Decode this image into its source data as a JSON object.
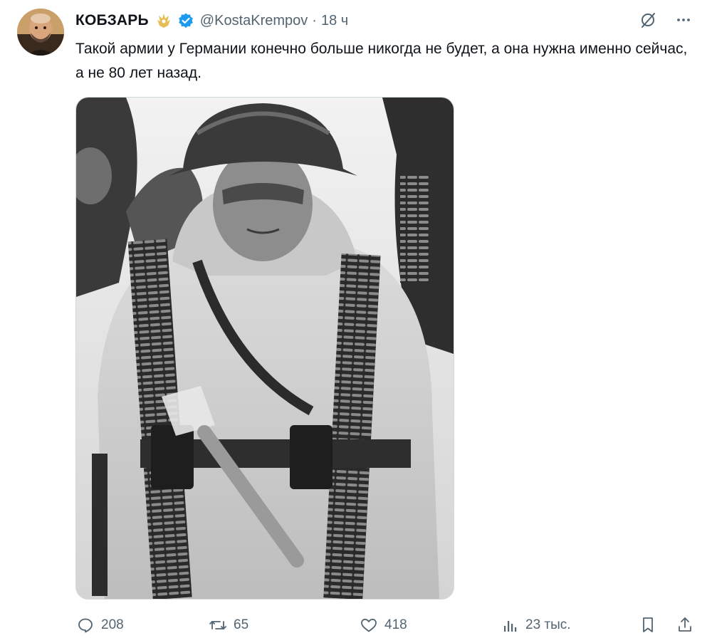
{
  "tweet": {
    "author": {
      "display_name": "КОБЗАРЬ",
      "handle": "@KostaKrempov",
      "separator": "·",
      "time": "18 ч",
      "badge_icon": "trident-icon",
      "verified_icon": "verified-check-icon"
    },
    "text": "Такой армии у Германии конечно больше никогда не будет, а она нужна именно сейчас, а не 80 лет назад.",
    "media": {
      "type": "photo",
      "colors": "black-and-white"
    },
    "top_actions": [
      "grok-icon",
      "more-icon"
    ],
    "actions": {
      "replies": "208",
      "reposts": "65",
      "likes": "418",
      "views": "23 тыс.",
      "bookmark_icon": "bookmark-icon",
      "share_icon": "share-icon"
    }
  },
  "colors": {
    "text": "#0f1419",
    "secondary": "#536471",
    "verified": "#1d9bf0",
    "badge_gold": "#e0b33a"
  }
}
